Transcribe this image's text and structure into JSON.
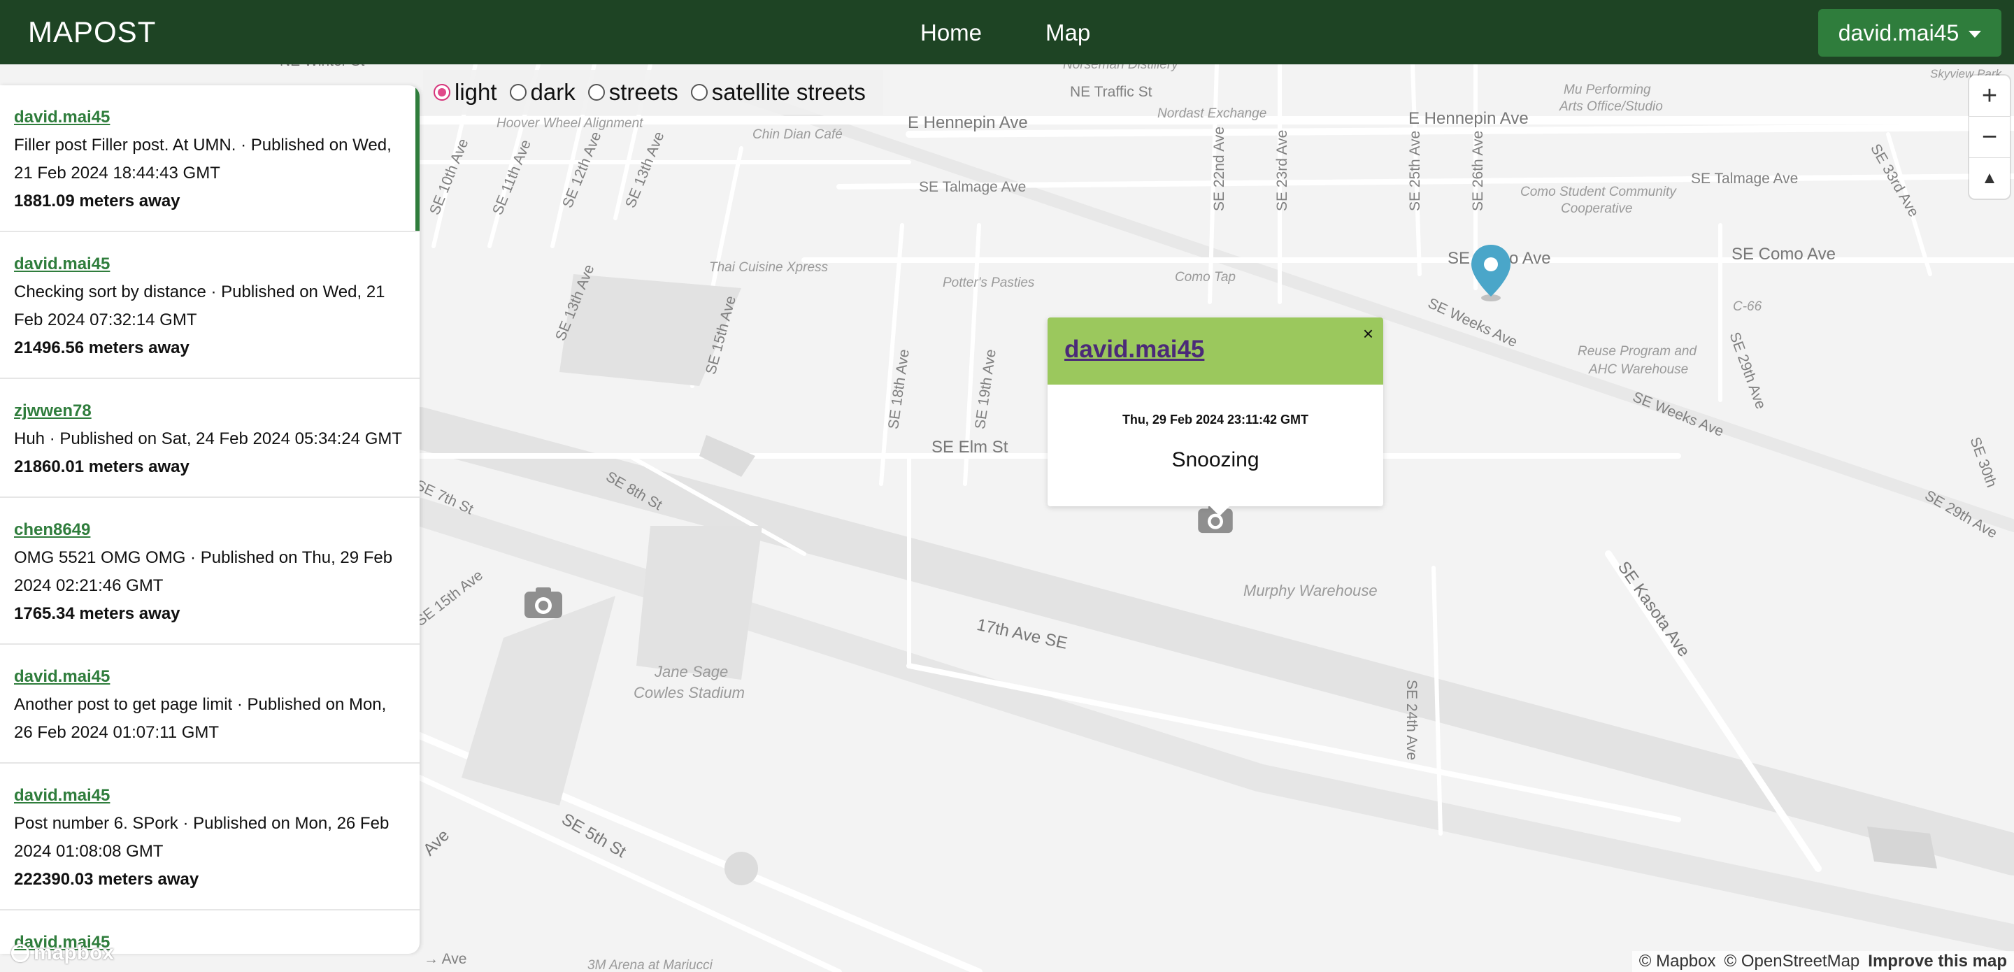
{
  "navbar": {
    "brand": "MAPOST",
    "links": {
      "home": "Home",
      "map": "Map"
    },
    "user": "david.mai45"
  },
  "style_options": {
    "items": [
      "light",
      "dark",
      "streets",
      "satellite streets"
    ],
    "selected": "light"
  },
  "posts": [
    {
      "author": "david.mai45",
      "text": "Filler post Filler post. At UMN. · Published on Wed, 21 Feb 2024 18:44:43 GMT",
      "distance": "1881.09 meters away"
    },
    {
      "author": "david.mai45",
      "text": "Checking sort by distance · Published on Wed, 21 Feb 2024 07:32:14 GMT",
      "distance": "21496.56 meters away"
    },
    {
      "author": "zjwwen78",
      "text": "Huh · Published on Sat, 24 Feb 2024 05:34:24 GMT",
      "distance": "21860.01 meters away"
    },
    {
      "author": "chen8649",
      "text": "OMG 5521 OMG OMG · Published on Thu, 29 Feb 2024 02:21:46 GMT",
      "distance": "1765.34 meters away"
    },
    {
      "author": "david.mai45",
      "text": "Another post to get page limit · Published on Mon, 26 Feb 2024 01:07:11 GMT",
      "distance": ""
    },
    {
      "author": "david.mai45",
      "text": "Post number 6. SPork · Published on Mon, 26 Feb 2024 01:08:08 GMT",
      "distance": "222390.03 meters away"
    },
    {
      "author": "david.mai45",
      "text": "",
      "distance": ""
    }
  ],
  "popup": {
    "author": "david.mai45",
    "close": "×",
    "date": "Thu, 29 Feb 2024 23:11:42 GMT",
    "body": "Snoozing"
  },
  "map_controls": {
    "zoom_in": "+",
    "zoom_out": "−",
    "compass": "▲"
  },
  "map_labels": {
    "ne_winter": "NE Winter St",
    "ne_traffic": "NE Traffic St",
    "norseman": "Norseman Distillery",
    "nordast": "Nordast Exchange",
    "e_hennepin1": "E Hennepin Ave",
    "e_hennepin2": "E Hennepin Ave",
    "hoover": "Hoover Wheel Alignment",
    "chin_dian": "Chin Dian Café",
    "mu": "Mu Performing",
    "mu2": "Arts Office/Studio",
    "skyview": "Skyview Park",
    "se10": "SE 10th Ave",
    "se11": "SE 11th Ave",
    "se12": "SE 12th Ave",
    "se13": "SE 13th Ave",
    "se13b": "SE 13th Ave",
    "se15": "SE 15th Ave",
    "se15b": "SE 15th Ave",
    "se18": "SE 18th Ave",
    "se19": "SE 19th Ave",
    "se22": "SE 22nd Ave",
    "se23": "SE 23rd Ave",
    "se24": "SE 24th Ave",
    "se25": "SE 25th Ave",
    "se26": "SE 26th Ave",
    "se29": "SE 29th Ave",
    "se29b": "SE 29th Ave",
    "se30": "SE 30th",
    "se33": "SE 33rd Ave",
    "talmage1": "SE Talmage Ave",
    "talmage2": "SE Talmage Ave",
    "como_student": "Como Student Community",
    "coop": "Cooperative",
    "como1": "SE Co",
    "como1b": "o Ave",
    "como2": "SE Como Ave",
    "thai": "Thai Cuisine Xpress",
    "potters": "Potter's Pasties",
    "como_tap": "Como Tap",
    "c66": "C-66",
    "weeks1": "SE Weeks Ave",
    "weeks2": "SE Weeks Ave",
    "reuse": "Reuse Program and",
    "ahc": "AHC Warehouse",
    "elm": "SE Elm St",
    "se7": "SE 7th St",
    "se8": "SE 8th St",
    "kasota": "SE Kasota Ave",
    "murphy": "Murphy Warehouse",
    "ave17": "17th Ave SE",
    "jane": "Jane Sage",
    "cowles": "Cowles Stadium",
    "se5": "SE 5th St",
    "ave_left": "Ave",
    "ave_bottom": "→ Ave",
    "arena": "3M Arena at Mariucci"
  },
  "attribution": {
    "mapbox": "© Mapbox",
    "osm": "© OpenStreetMap",
    "improve": "Improve this map"
  },
  "logo": "mapbox"
}
